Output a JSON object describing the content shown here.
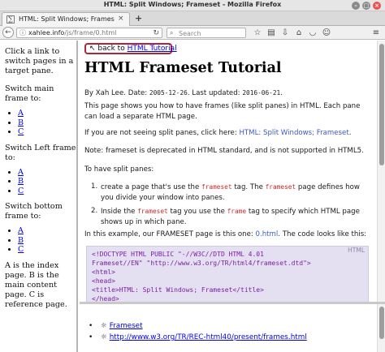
{
  "window": {
    "title": "HTML: Split Windows; Frameset - Mozilla Firefox",
    "buttons": {
      "minimize": "–",
      "maximize": "□",
      "close": "×"
    }
  },
  "tab": {
    "favicon": "∑",
    "label": "HTML: Split Windows; Frames",
    "close": "×",
    "new_tab": "+"
  },
  "navbar": {
    "back": "←",
    "url_info": "ⓘ",
    "url_host": "xahlee.info",
    "url_path": "/js/frame/0.html",
    "reload": "↻",
    "search_placeholder": "Search",
    "icons": [
      "star-icon",
      "reading-list-icon",
      "download-icon",
      "home-icon",
      "pocket-icon",
      "emoji-icon",
      "menu-icon"
    ]
  },
  "left_frame": {
    "intro": "Click a link to switch pages in a target pane.",
    "groups": [
      {
        "heading": "Switch main frame to:",
        "links": [
          "A",
          "B",
          "C"
        ]
      },
      {
        "heading": "Switch Left frame to:",
        "links": [
          "A",
          "B",
          "C"
        ]
      },
      {
        "heading": "Switch bottom frame to:",
        "links": [
          "A",
          "B",
          "C"
        ]
      }
    ],
    "footer": "A is the index page. B is the main content page. C is reference page."
  },
  "main_frame": {
    "back_arrow": "↖",
    "back_prefix": "back to",
    "back_link": "HTML Tutorial",
    "title": "HTML Frameset Tutorial",
    "byline_prefix": "By Xah Lee. Date:",
    "date": "2005-12-26",
    "updated_label": ". Last updated:",
    "updated": "2016-06-21",
    "byline_suffix": ".",
    "intro": "This page shows you how to have frames (like split panes) in HTML. Each pane can load a separate HTML page.",
    "not_seeing": "If you are not seeing split panes, click here:",
    "not_seeing_link": "HTML: Split Windows; Frameset",
    "not_seeing_end": ".",
    "note": "Note: frameset is deprecated in HTML standard, and is not supported in HTML5.",
    "to_have": "To have split panes:",
    "step1": {
      "num": "1.",
      "a": "create a page that's use the",
      "kw": "frameset",
      "b": "tag. The",
      "kw2": "frameset",
      "c": "page defines how you divide your window into panes."
    },
    "step2": {
      "num": "2.",
      "a": "Inside the",
      "kw": "frameset",
      "b": "tag you use the",
      "kw2": "frame",
      "c": "tag to specify which HTML page shows up in which pane."
    },
    "example_a": "In this example, our FRAMESET page is this one:",
    "example_link": "0.html",
    "example_b": ". The code looks like this:",
    "code_lang": "HTML",
    "code_lines": [
      "<!DOCTYPE HTML PUBLIC \"-//W3C//DTD HTML 4.01",
      "Frameset//EN\" \"http://www.w3.org/TR/html4/frameset.dtd\">",
      "<html>",
      "<head>",
      "<title>HTML: Split Windows; Frameset</title>",
      "</head>"
    ]
  },
  "bottom_frame": {
    "items": [
      {
        "bullet": "•",
        "symbol": "☼",
        "text": "Frameset"
      },
      {
        "bullet": "•",
        "symbol": "☼",
        "text": "http://www.w3.org/TR/REC-html40/present/frames.html"
      }
    ]
  }
}
